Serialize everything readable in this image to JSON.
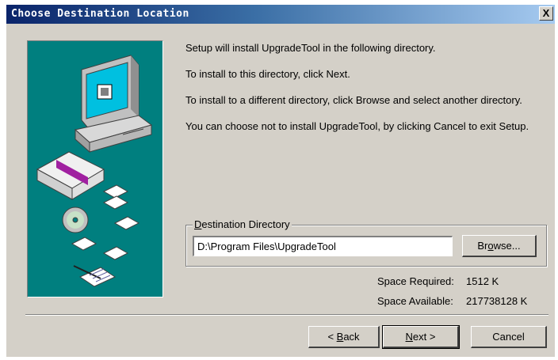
{
  "window": {
    "title": "Choose Destination Location",
    "close_label": "X"
  },
  "intro": {
    "line1": "Setup will install UpgradeTool in the following directory.",
    "line2": "To install to this directory, click Next.",
    "line3": "To install to a different directory, click Browse and select another directory.",
    "line4": "You can choose not to install UpgradeTool, by clicking Cancel to exit Setup."
  },
  "destination": {
    "group_label_key": "D",
    "group_label_rest": "estination Directory",
    "path": "D:\\Program Files\\UpgradeTool",
    "browse_key": "o",
    "browse_pre": "Br",
    "browse_post": "wse..."
  },
  "space": {
    "required_label": "Space Required:",
    "required_value": "1512 K",
    "available_label": "Space Available:",
    "available_value": "217738128 K"
  },
  "buttons": {
    "back_pre": "< ",
    "back_key": "B",
    "back_post": "ack",
    "next_key": "N",
    "next_post": "ext >",
    "cancel": "Cancel"
  }
}
